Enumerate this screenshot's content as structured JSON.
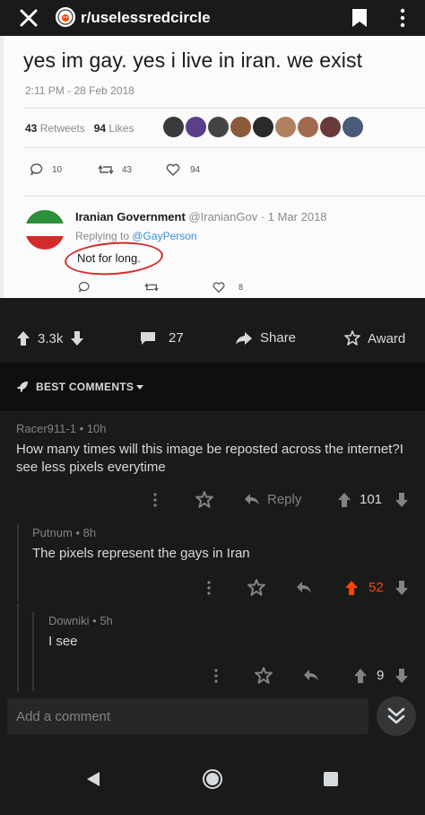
{
  "topbar": {
    "subreddit": "r/uselessredcircle"
  },
  "tweet": {
    "text": "yes im gay. yes i live in iran. we exist",
    "time": "2:11 PM - 28 Feb 2018",
    "retweets_count": "43",
    "retweets_label": "Retweets",
    "likes_count": "94",
    "likes_label": "Likes",
    "reply_count": "10",
    "retweet_count": "43",
    "like_count": "94",
    "reply": {
      "name": "Iranian Government",
      "handle": "@IranianGov · 1 Mar 2018",
      "replying_prefix": "Replying to ",
      "replying_to": "@GayPerson",
      "text": "Not for long.",
      "like_count": "8"
    }
  },
  "post_actions": {
    "votes": "3.3k",
    "comments": "27",
    "share_label": "Share",
    "award_label": "Award"
  },
  "sort": {
    "label": "BEST COMMENTS"
  },
  "comments": [
    {
      "author": "Racer911-1",
      "age": "10h",
      "body": "How many times will this image be reposted across the internet?I see less pixels everytime",
      "reply_label": "Reply",
      "votes": "101"
    },
    {
      "author": "Putnum",
      "age": "8h",
      "body": "The pixels represent the gays in Iran",
      "votes": "52"
    },
    {
      "author": "Downiki",
      "age": "5h",
      "body": "I see",
      "votes": "9"
    }
  ],
  "add_comment": {
    "placeholder": "Add a comment"
  },
  "colors": {
    "background": "#1a1a1b",
    "upvote_active": "#ff4500",
    "text": "#d7dadc",
    "muted": "#818384"
  }
}
